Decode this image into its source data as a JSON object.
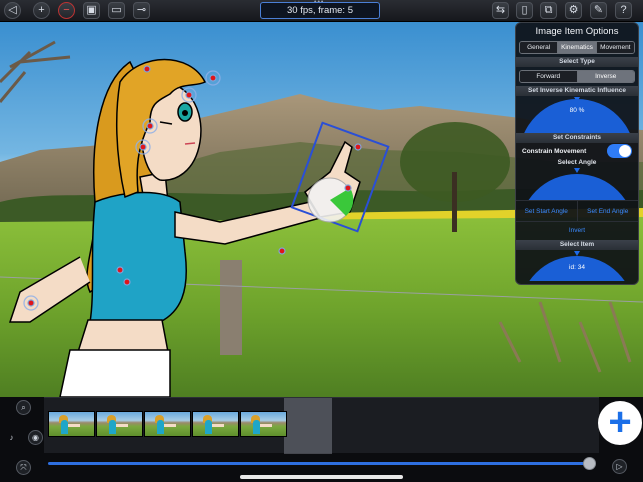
{
  "toolbar": {
    "status": "30 fps, frame: 5",
    "dots": "•••",
    "left_icons": [
      "back-icon",
      "add-icon",
      "remove-icon",
      "camera-icon",
      "photo-icon",
      "key-icon"
    ],
    "right_icons": [
      "bones-icon",
      "clipboard-icon",
      "export-icon",
      "gear-icon",
      "wrench-icon",
      "help-icon"
    ],
    "glyphs": {
      "back": "◁",
      "add": "+",
      "remove": "−",
      "camera": "▣",
      "photo": "▭",
      "key": "⊸",
      "bones": "⇆",
      "clipboard": "▯",
      "export": "⧉",
      "gear": "⚙",
      "wrench": "✎",
      "help": "?"
    }
  },
  "panel": {
    "title": "Image Item Options",
    "tabs": [
      "General",
      "Kinematics",
      "Movement"
    ],
    "selected_tab": "Kinematics",
    "select_type_label": "Select Type",
    "type_options": [
      "Forward",
      "Inverse"
    ],
    "selected_type": "Inverse",
    "influence_label": "Set Inverse Kinematic Influence",
    "influence_value": "80 %",
    "constraints_label": "Set Constraints",
    "constrain_label": "Constrain Movement",
    "constrain_on": true,
    "select_angle_label": "Select Angle",
    "start_angle_button": "Set Start Angle",
    "end_angle_button": "Set End Angle",
    "invert_button": "Invert",
    "select_item_label": "Select Item",
    "item_id": "id: 34"
  },
  "timeline": {
    "frame_count": 5,
    "selected_frame": 5,
    "playback_fraction": 0.98,
    "tools": {
      "zoom": "⌕",
      "mic": "♪",
      "record": "◉",
      "expand": "⤧",
      "play": "▷"
    },
    "add_symbol": "+"
  },
  "colors": {
    "accent": "#1b6fe8",
    "panel_bg": "#0e1117",
    "toggle_on": "#2f7cf6",
    "frame_border": "#2a4fd6"
  }
}
